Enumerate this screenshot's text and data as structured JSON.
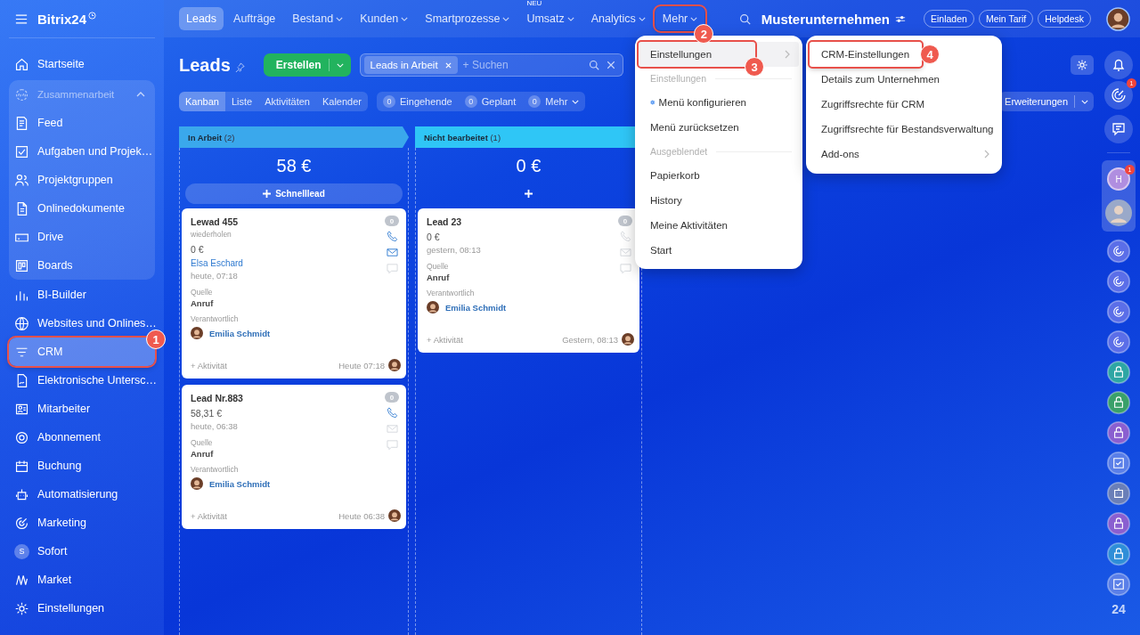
{
  "sidebar": {
    "logo": "Bitrix24",
    "items": [
      {
        "kind": "item",
        "label": "Startseite",
        "selected": false
      },
      {
        "kind": "group",
        "label": "Zusammenarbeit",
        "expanded": true,
        "children": [
          {
            "kind": "item",
            "label": "Feed",
            "selected": false
          },
          {
            "kind": "item",
            "label": "Aufgaben und Projek…",
            "selected": false
          },
          {
            "kind": "item",
            "label": "Projektgruppen",
            "selected": false
          },
          {
            "kind": "item",
            "label": "Onlinedokumente",
            "selected": false
          },
          {
            "kind": "item",
            "label": "Drive",
            "selected": false
          },
          {
            "kind": "item",
            "label": "Boards",
            "selected": false
          }
        ]
      },
      {
        "kind": "item",
        "label": "BI-Builder",
        "selected": false
      },
      {
        "kind": "item",
        "label": "Websites und Onlines…",
        "selected": false
      },
      {
        "kind": "item",
        "label": "CRM",
        "selected": true,
        "callout": "1"
      },
      {
        "kind": "item",
        "label": "Elektronische Untersc…",
        "selected": false
      },
      {
        "kind": "item",
        "label": "Mitarbeiter",
        "selected": false
      },
      {
        "kind": "item",
        "label": "Abonnement",
        "selected": false
      },
      {
        "kind": "item",
        "label": "Buchung",
        "selected": false
      },
      {
        "kind": "item",
        "label": "Automatisierung",
        "selected": false
      },
      {
        "kind": "item",
        "label": "Marketing",
        "selected": false
      },
      {
        "kind": "item",
        "label": "Sofort",
        "selected": false,
        "badge": "S"
      },
      {
        "kind": "item",
        "label": "Market",
        "selected": false
      },
      {
        "kind": "item",
        "label": "Einstellungen",
        "selected": false
      }
    ]
  },
  "topnav": {
    "items": [
      {
        "label": "Leads",
        "selected": true,
        "dropdown": false
      },
      {
        "label": "Aufträge",
        "selected": false,
        "dropdown": false
      },
      {
        "label": "Bestand",
        "selected": false,
        "dropdown": true
      },
      {
        "label": "Kunden",
        "selected": false,
        "dropdown": true
      },
      {
        "label": "Smartprozesse",
        "selected": false,
        "dropdown": true
      },
      {
        "label": "Umsatz",
        "selected": false,
        "dropdown": true,
        "tag": "NEU"
      },
      {
        "label": "Analytics",
        "selected": false,
        "dropdown": true
      },
      {
        "label": "Mehr",
        "selected": false,
        "dropdown": true,
        "callout": "2"
      }
    ]
  },
  "header": {
    "company": "Musterunternehmen",
    "buttons": [
      "Einladen",
      "Mein Tarif",
      "Helpdesk"
    ]
  },
  "toolbar": {
    "title": "Leads",
    "create_button": "Erstellen",
    "filter": {
      "tag": "Leads in Arbeit",
      "placeholder": "+ Suchen"
    }
  },
  "views": [
    {
      "label": "Kanban",
      "selected": true
    },
    {
      "label": "Liste",
      "selected": false
    },
    {
      "label": "Aktivitäten",
      "selected": false
    },
    {
      "label": "Kalender",
      "selected": false
    }
  ],
  "counters": [
    {
      "count": "0",
      "label": "Eingehende",
      "dropdown": false
    },
    {
      "count": "0",
      "label": "Geplant",
      "dropdown": false
    },
    {
      "count": "0",
      "label": "Mehr",
      "dropdown": true
    }
  ],
  "extensions_button": "Erweiterungen",
  "columns": [
    {
      "title": "In Arbeit",
      "count": "(2)",
      "color": "#3aa8ec",
      "total": "58 €",
      "add_label": "Schnelllead",
      "cards": [
        {
          "title": "Lewad 455",
          "subtitle": "wiederholen",
          "amount": "0 €",
          "contact": "Elsa Eschard",
          "date": "heute, 07:18",
          "source_label": "Quelle",
          "source": "Anruf",
          "responsible_label": "Verantwortlich",
          "responsible": "Emilia Schmidt",
          "activity": "+ Aktivität",
          "footer_date": "Heute 07:18",
          "counter": "0",
          "channels": [
            {
              "kind": "phone",
              "active": true
            },
            {
              "kind": "mail",
              "active": true
            },
            {
              "kind": "chat",
              "active": false
            }
          ]
        },
        {
          "title": "Lead Nr.883",
          "amount": "58,31 €",
          "date": "heute, 06:38",
          "source_label": "Quelle",
          "source": "Anruf",
          "responsible_label": "Verantwortlich",
          "responsible": "Emilia Schmidt",
          "activity": "+ Aktivität",
          "footer_date": "Heute 06:38",
          "counter": "0",
          "channels": [
            {
              "kind": "phone",
              "active": true
            },
            {
              "kind": "mail",
              "active": false
            },
            {
              "kind": "chat",
              "active": false
            }
          ]
        }
      ]
    },
    {
      "title": "Nicht bearbeitet",
      "count": "(1)",
      "color": "#2fc6f6",
      "total": "0 €",
      "cards": [
        {
          "title": "Lead 23",
          "amount": "0 €",
          "date": "gestern, 08:13",
          "source_label": "Quelle",
          "source": "Anruf",
          "responsible_label": "Verantwortlich",
          "responsible": "Emilia Schmidt",
          "activity": "+ Aktivität",
          "footer_date": "Gestern, 08:13",
          "counter": "0",
          "channels": [
            {
              "kind": "phone",
              "active": false
            },
            {
              "kind": "mail",
              "active": false
            },
            {
              "kind": "chat",
              "active": false
            }
          ]
        }
      ]
    }
  ],
  "menus": [
    {
      "items": [
        {
          "kind": "item",
          "label": "Einstellungen",
          "selected": true,
          "submenu": true,
          "callout": "3"
        },
        {
          "kind": "section",
          "label": "Einstellungen"
        },
        {
          "kind": "config",
          "label": "Menü konfigurieren",
          "selected": false,
          "submenu": false
        },
        {
          "kind": "item",
          "label": "Menü zurücksetzen",
          "selected": false,
          "submenu": false
        },
        {
          "kind": "section",
          "label": "Ausgeblendet"
        },
        {
          "kind": "item",
          "label": "Papierkorb",
          "selected": false,
          "submenu": false
        },
        {
          "kind": "item",
          "label": "History",
          "selected": false,
          "submenu": false
        },
        {
          "kind": "item",
          "label": "Meine Aktivitäten",
          "selected": false,
          "submenu": false
        },
        {
          "kind": "item",
          "label": "Start",
          "selected": false,
          "submenu": false
        }
      ]
    },
    {
      "items": [
        {
          "kind": "item",
          "label": "CRM-Einstellungen",
          "selected": false,
          "submenu": false,
          "callout": "4"
        },
        {
          "kind": "item",
          "label": "Details zum Unternehmen",
          "selected": false,
          "submenu": false
        },
        {
          "kind": "item",
          "label": "Zugriffsrechte für CRM",
          "selected": false,
          "submenu": false
        },
        {
          "kind": "item",
          "label": "Zugriffsrechte für Bestandsverwaltung",
          "selected": false,
          "submenu": false
        },
        {
          "kind": "item",
          "label": "Add-ons",
          "selected": false,
          "submenu": true
        }
      ]
    }
  ],
  "right_rail": {
    "badge": "1",
    "chat": {
      "initial": "H",
      "badge": "1"
    },
    "logo": "24"
  }
}
